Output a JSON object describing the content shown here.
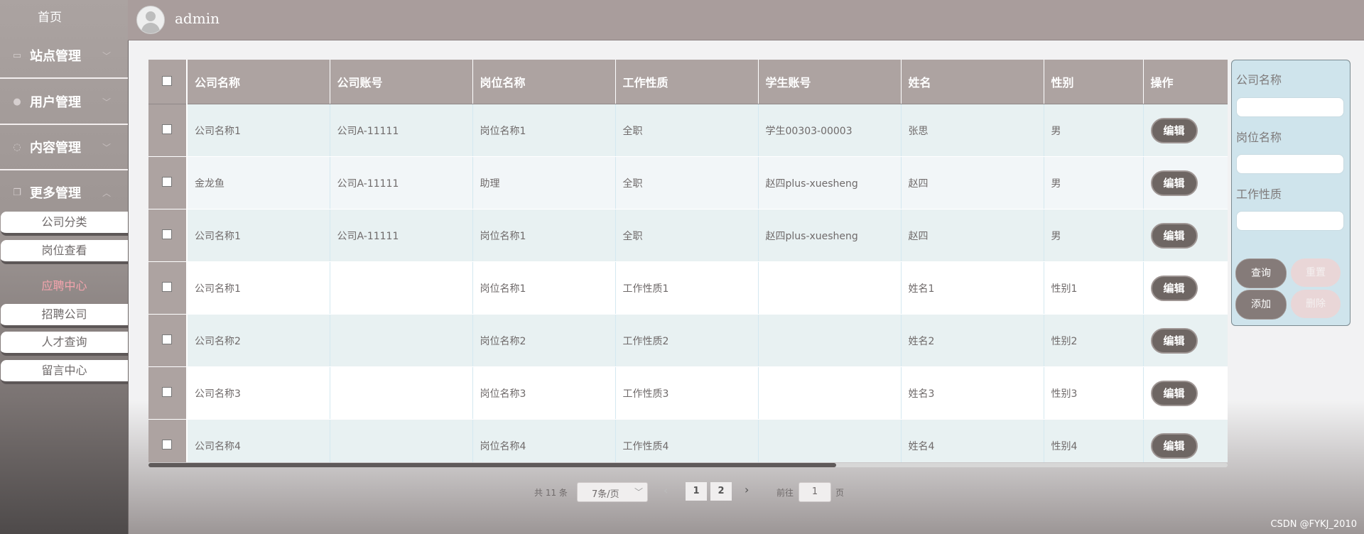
{
  "sidebar": {
    "home": "首页",
    "groups": [
      {
        "label": "站点管理",
        "icon": "monitor-icon"
      },
      {
        "label": "用户管理",
        "icon": "user-icon"
      },
      {
        "label": "内容管理",
        "icon": "chat-icon"
      },
      {
        "label": "更多管理",
        "icon": "copy-icon"
      }
    ],
    "subitems": [
      "公司分类",
      "岗位查看",
      "应聘中心",
      "招聘公司",
      "人才查询",
      "留言中心"
    ],
    "active_subitem": "应聘中心"
  },
  "header": {
    "username": "admin"
  },
  "table": {
    "columns": [
      "公司名称",
      "公司账号",
      "岗位名称",
      "工作性质",
      "学生账号",
      "姓名",
      "性别",
      "操作"
    ],
    "rows": [
      [
        "公司名称1",
        "公司A-11111",
        "岗位名称1",
        "全职",
        "学生00303-00003",
        "张思",
        "男"
      ],
      [
        "金龙鱼",
        "公司A-11111",
        "助理",
        "全职",
        "赵四plus-xuesheng",
        "赵四",
        "男"
      ],
      [
        "公司名称1",
        "公司A-11111",
        "岗位名称1",
        "全职",
        "赵四plus-xuesheng",
        "赵四",
        "男"
      ],
      [
        "公司名称1",
        "",
        "岗位名称1",
        "工作性质1",
        "",
        "姓名1",
        "性别1"
      ],
      [
        "公司名称2",
        "",
        "岗位名称2",
        "工作性质2",
        "",
        "姓名2",
        "性别2"
      ],
      [
        "公司名称3",
        "",
        "岗位名称3",
        "工作性质3",
        "",
        "姓名3",
        "性别3"
      ],
      [
        "公司名称4",
        "",
        "岗位名称4",
        "工作性质4",
        "",
        "姓名4",
        "性别4"
      ]
    ],
    "edit_label": "编辑"
  },
  "pagination": {
    "total": "共 11 条",
    "page_size": "7条/页",
    "pages": [
      "1",
      "2"
    ],
    "goto_label": "前往",
    "goto_value": "1",
    "page_unit": "页"
  },
  "search": {
    "fields": [
      {
        "label": "公司名称",
        "value": ""
      },
      {
        "label": "岗位名称",
        "value": ""
      },
      {
        "label": "工作性质",
        "value": ""
      }
    ],
    "buttons": {
      "query": "查询",
      "reset": "重置",
      "add": "添加",
      "delete": "删除"
    }
  },
  "watermark": "CSDN @FYKJ_2010"
}
